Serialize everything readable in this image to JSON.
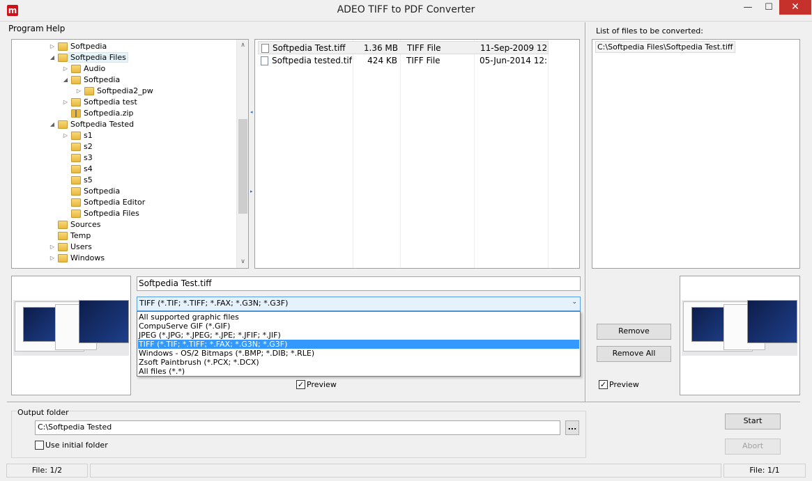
{
  "window": {
    "title": "ADEO TIFF to PDF Converter",
    "icon_glyph": "m",
    "controls": {
      "minimize": "—",
      "maximize": "☐",
      "close": "✕"
    }
  },
  "menu": [
    "Program",
    "Help"
  ],
  "tree": {
    "items": [
      {
        "label": "Softpedia",
        "arrow": "▷",
        "icon": "folder-icon"
      },
      {
        "label": "Softpedia Files",
        "arrow": "◢",
        "icon": "folder-icon",
        "selected": true
      },
      {
        "label": "Audio",
        "arrow": "▷",
        "icon": "folder-icon"
      },
      {
        "label": "Softpedia",
        "arrow": "◢",
        "icon": "folder-icon"
      },
      {
        "label": "Softpedia2_pw",
        "arrow": "▷",
        "icon": "folder-icon"
      },
      {
        "label": "Softpedia test",
        "arrow": "▷",
        "icon": "folder-icon"
      },
      {
        "label": "Softpedia.zip",
        "arrow": "",
        "icon": "zip-folder-icon"
      },
      {
        "label": "Softpedia Tested",
        "arrow": "◢",
        "icon": "folder-icon"
      },
      {
        "label": "s1",
        "arrow": "▷",
        "icon": "folder-icon"
      },
      {
        "label": "s2",
        "arrow": "",
        "icon": "folder-icon"
      },
      {
        "label": "s3",
        "arrow": "",
        "icon": "folder-icon"
      },
      {
        "label": "s4",
        "arrow": "",
        "icon": "folder-icon"
      },
      {
        "label": "s5",
        "arrow": "",
        "icon": "folder-icon"
      },
      {
        "label": "Softpedia",
        "arrow": "",
        "icon": "folder-icon"
      },
      {
        "label": "Softpedia Editor",
        "arrow": "",
        "icon": "folder-icon"
      },
      {
        "label": "Softpedia Files",
        "arrow": "",
        "icon": "folder-icon"
      },
      {
        "label": "Sources",
        "arrow": "",
        "icon": "folder-icon"
      },
      {
        "label": "Temp",
        "arrow": "",
        "icon": "folder-icon"
      },
      {
        "label": "Users",
        "arrow": "▷",
        "icon": "folder-icon"
      },
      {
        "label": "Windows",
        "arrow": "▷",
        "icon": "folder-icon"
      }
    ]
  },
  "files": {
    "rows": [
      {
        "name": "Softpedia Test.tiff",
        "size": "1.36 MB",
        "type": "TIFF File",
        "date": "11-Sep-2009 12...",
        "selected": true
      },
      {
        "name": "Softpedia tested.tiff",
        "size": "424 KB",
        "type": "TIFF File",
        "date": "05-Jun-2014 12:..."
      }
    ]
  },
  "convert": {
    "label": "List of files to be converted:",
    "items": [
      "C:\\Softpedia Files\\Softpedia Test.tiff"
    ]
  },
  "filename_field": "Softpedia Test.tiff",
  "filetype": {
    "selected": "TIFF (*.TIF; *.TIFF; *.FAX; *.G3N; *.G3F)",
    "options": [
      "All supported graphic files",
      "CompuServe GIF (*.GIF)",
      "JPEG (*.JPG; *.JPEG;  *.JPE; *.JFIF; *.JIF)",
      "TIFF (*.TIF; *.TIFF; *.FAX; *.G3N; *.G3F)",
      "Windows - OS/2 Bitmaps (*.BMP; *.DIB; *.RLE)",
      "Zsoft Paintbrush (*.PCX; *.DCX)",
      "All files (*.*)"
    ],
    "selected_index": 3
  },
  "preview_left": {
    "label": "Preview",
    "checked": true,
    "check_glyph": "✓"
  },
  "preview_right": {
    "label": "Preview",
    "checked": true,
    "check_glyph": "✓"
  },
  "buttons": {
    "remove": "Remove",
    "remove_all": "Remove All",
    "start": "Start",
    "abort": "Abort",
    "browse": "..."
  },
  "output": {
    "label": "Output folder",
    "path": "C:\\Softpedia Tested",
    "use_initial_label": "Use initial folder",
    "use_initial_checked": false
  },
  "status": {
    "left": "File: 1/2",
    "right": "File: 1/1"
  },
  "scroll_glyphs": {
    "up": "∧",
    "down": "∨",
    "split": "◂",
    "split2": "▸",
    "chevron": "⌄"
  },
  "colors": {
    "selection": "#3399ff",
    "close": "#c7312c"
  }
}
